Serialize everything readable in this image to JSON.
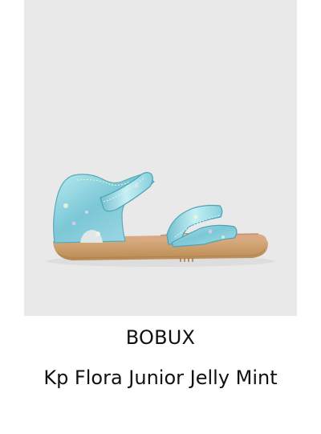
{
  "product": {
    "brand": "BOBUX",
    "name": "Kp Flora Junior Jelly Mint",
    "image_icon": "sandal-product-image",
    "colors": {
      "image_background": "#e9e9ea",
      "upper": "#8fd2df",
      "sole": "#c79a66",
      "footbed": "#d7a780",
      "text": "#111111"
    }
  }
}
